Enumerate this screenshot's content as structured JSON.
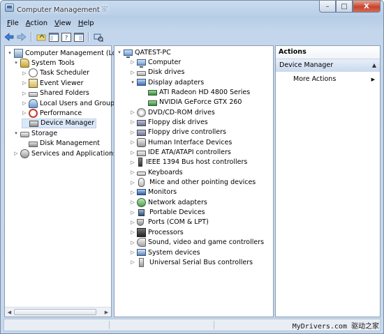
{
  "window": {
    "title": "Computer Management",
    "title_overlay": "家",
    "buttons": {
      "minimize": "–",
      "maximize": "□",
      "close": "X"
    }
  },
  "menu": [
    {
      "id": "file",
      "label": "File",
      "mnemonic": "F",
      "rest": "ile"
    },
    {
      "id": "action",
      "label": "Action",
      "mnemonic": "A",
      "rest": "ction"
    },
    {
      "id": "view",
      "label": "View",
      "mnemonic": "V",
      "rest": "iew"
    },
    {
      "id": "help",
      "label": "Help",
      "mnemonic": "H",
      "rest": "elp"
    }
  ],
  "toolbar": {
    "icons": [
      "back-arrow-icon",
      "forward-arrow-icon",
      "up-folder-icon",
      "show-hide-console-tree-icon",
      "help-icon",
      "properties-icon",
      "scan-hardware-icon"
    ]
  },
  "left_tree": [
    {
      "label": "Computer Management (Local",
      "icon": "computer-management-icon"
    },
    {
      "label": "System Tools",
      "icon": "system-tools-icon"
    },
    {
      "label": "Task Scheduler",
      "icon": "task-scheduler-icon"
    },
    {
      "label": "Event Viewer",
      "icon": "event-viewer-icon"
    },
    {
      "label": "Shared Folders",
      "icon": "shared-folders-icon"
    },
    {
      "label": "Local Users and Groups",
      "icon": "local-users-icon"
    },
    {
      "label": "Performance",
      "icon": "performance-icon"
    },
    {
      "label": "Device Manager",
      "icon": "device-manager-icon",
      "selected": true
    },
    {
      "label": "Storage",
      "icon": "storage-icon"
    },
    {
      "label": "Disk Management",
      "icon": "disk-management-icon"
    },
    {
      "label": "Services and Applications",
      "icon": "services-icon"
    }
  ],
  "device_tree": {
    "root": "QATEST-PC",
    "categories": [
      {
        "label": "Computer",
        "icon": "computer-icon"
      },
      {
        "label": "Disk drives",
        "icon": "disk-drive-icon"
      },
      {
        "label": "Display adapters",
        "icon": "display-adapter-icon",
        "expanded": true,
        "children": [
          "ATI Radeon HD 4800 Series",
          "NVIDIA GeForce GTX 260"
        ]
      },
      {
        "label": "DVD/CD-ROM drives",
        "icon": "dvd-icon"
      },
      {
        "label": "Floppy disk drives",
        "icon": "floppy-disk-icon"
      },
      {
        "label": "Floppy drive controllers",
        "icon": "floppy-controller-icon"
      },
      {
        "label": "Human Interface Devices",
        "icon": "hid-icon"
      },
      {
        "label": "IDE ATA/ATAPI controllers",
        "icon": "ide-controller-icon"
      },
      {
        "label": "IEEE 1394 Bus host controllers",
        "icon": "ieee1394-icon"
      },
      {
        "label": "Keyboards",
        "icon": "keyboard-icon"
      },
      {
        "label": "Mice and other pointing devices",
        "icon": "mouse-icon"
      },
      {
        "label": "Monitors",
        "icon": "monitor-icon"
      },
      {
        "label": "Network adapters",
        "icon": "network-adapter-icon"
      },
      {
        "label": "Portable Devices",
        "icon": "portable-device-icon"
      },
      {
        "label": "Ports (COM & LPT)",
        "icon": "port-icon"
      },
      {
        "label": "Processors",
        "icon": "processor-icon"
      },
      {
        "label": "Sound, video and game controllers",
        "icon": "sound-icon"
      },
      {
        "label": "System devices",
        "icon": "system-devices-icon"
      },
      {
        "label": "Universal Serial Bus controllers",
        "icon": "usb-icon"
      }
    ]
  },
  "actions": {
    "header": "Actions",
    "section": "Device Manager",
    "more": "More Actions"
  },
  "watermark": "MyDrivers.com 驱动之家"
}
